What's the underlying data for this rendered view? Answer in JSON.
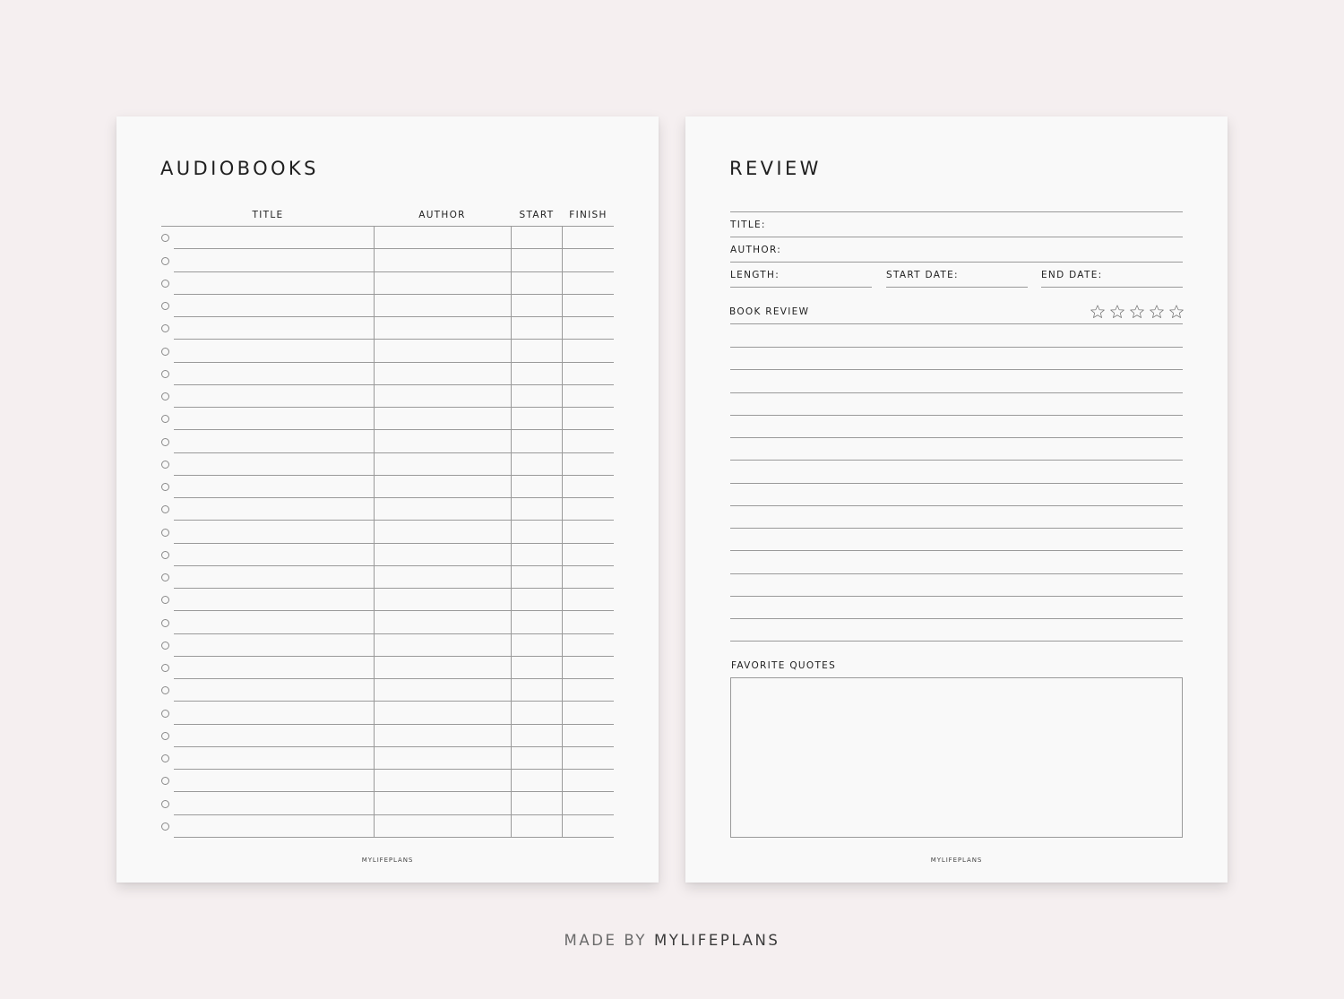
{
  "audiobooks": {
    "title": "AUDIOBOOKS",
    "columns": [
      "TITLE",
      "AUTHOR",
      "START",
      "FINISH"
    ],
    "row_count": 27,
    "footer": "MYLIFEPLANS"
  },
  "review": {
    "title": "REVIEW",
    "fields": {
      "title_label": "TITLE:",
      "author_label": "AUTHOR:",
      "length_label": "LENGTH:",
      "start_date_label": "START DATE:",
      "end_date_label": "END DATE:"
    },
    "book_review_label": "BOOK REVIEW",
    "rating": {
      "max_stars": 5,
      "filled": 0,
      "icon": "star-outline-icon"
    },
    "review_line_count": 14,
    "favorite_quotes_label": "FAVORITE QUOTES",
    "footer": "MYLIFEPLANS"
  },
  "credit": {
    "prefix": "MADE BY",
    "brand": "MYLIFEPLANS"
  },
  "colors": {
    "background": "#f5eff0",
    "paper": "#f9f9f9",
    "rule": "#9a9a9a",
    "text": "#1f1f1f"
  }
}
